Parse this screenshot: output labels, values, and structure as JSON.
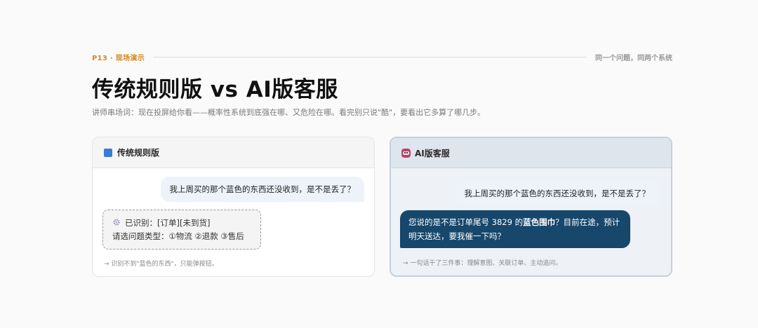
{
  "header": {
    "eyebrow": "P13 · 现场演示",
    "top_right": "同一个问题，同两个系统",
    "title": "传统规则版 vs AI版客服",
    "subtitle": "讲师串场词：现在投屏给你看——概率性系统到底强在哪、又危险在哪。看完别只说\"酷\"，要看出它多算了哪几步。"
  },
  "left_panel": {
    "title": "传统规则版",
    "icon": "blue-square-icon",
    "user_message": "我上周买的那个蓝色的东西还没收到，是不是丢了？",
    "bot_line1": "已识别：[订单][未到货]",
    "bot_line2": "请选问题类型：①物流 ②退款 ③售后",
    "note": "→ 识别不到\"蓝色的东西\"，只能弹按钮。"
  },
  "right_panel": {
    "title": "AI版客服",
    "icon": "robot-icon",
    "user_message": "我上周买的那个蓝色的东西还没收到，是不是丢了？",
    "bot_pre": "您说的是不是订单尾号 3829 的",
    "bot_bold": "蓝色围巾",
    "bot_post": "？目前在途，预计明天送达，要我催一下吗？",
    "note": "→ 一句话干了三件事：理解意图、关联订单、主动追问。"
  },
  "colors": {
    "accent": "#d4871c",
    "bot_bubble": "#17476b",
    "left_icon": "#3a7bd5"
  }
}
